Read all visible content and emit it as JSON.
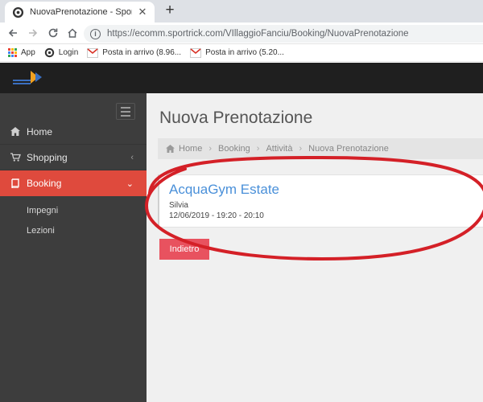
{
  "browser": {
    "tab_title": "NuovaPrenotazione - Sportrick S",
    "url": "https://ecomm.sportrick.com/VIllaggioFanciu/Booking/NuovaPrenotazione",
    "bookmarks": [
      {
        "label": "App"
      },
      {
        "label": "Login"
      },
      {
        "label": "Posta in arrivo (8.96..."
      },
      {
        "label": "Posta in arrivo (5.20..."
      }
    ]
  },
  "sidebar": {
    "items": [
      {
        "label": "Home"
      },
      {
        "label": "Shopping"
      },
      {
        "label": "Booking"
      }
    ],
    "subitems": [
      {
        "label": "Impegni"
      },
      {
        "label": "Lezioni"
      }
    ]
  },
  "main": {
    "title": "Nuova Prenotazione",
    "breadcrumb": [
      "Home",
      "Booking",
      "Attività",
      "Nuova Prenotazione"
    ],
    "card": {
      "title": "AcquaGym Estate",
      "instructor": "Silvia",
      "datetime": "12/06/2019 - 19:20 - 20:10"
    },
    "back_label": "Indietro"
  },
  "colors": {
    "sidebar_bg": "#3d3d3d",
    "active_item": "#df4a3d",
    "header_bg": "#1f1f1f",
    "card_title": "#4a90d9",
    "back_button": "#e8525f",
    "annotation": "#d42027"
  }
}
